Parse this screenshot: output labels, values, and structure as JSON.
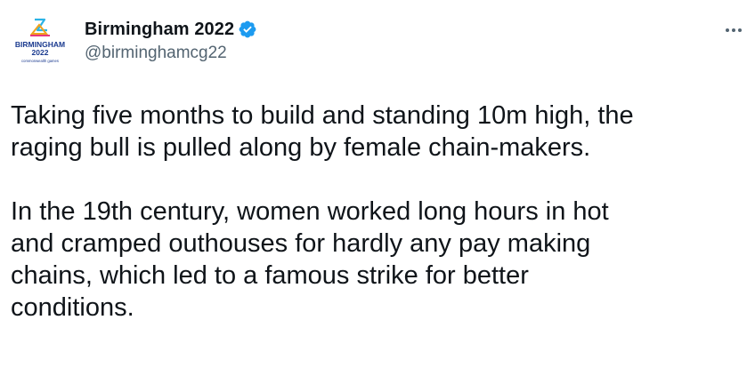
{
  "tweet": {
    "author": {
      "display_name": "Birmingham 2022",
      "handle": "@birminghamcg22",
      "verified": true,
      "avatar": {
        "icon": "birmingham-2022-logo",
        "logo_text_line1": "BIRMINGHAM",
        "logo_text_line2": "2022",
        "logo_text_line3": "commonwealth games"
      }
    },
    "more_icon": "more-horizontal-icon",
    "paragraphs": [
      {
        "lines": [
          "Taking five months to build and standing 10m high, the",
          "raging bull is pulled along by female chain-makers."
        ]
      },
      {
        "lines": [
          "In the 19th century, women worked long hours in hot",
          "and cramped outhouses for hardly any pay making",
          "chains, which led to a famous strike for better",
          "conditions."
        ]
      }
    ]
  },
  "colors": {
    "text": "#0f1419",
    "secondary_text": "#536471",
    "verified_blue": "#1d9bf0",
    "logo_blue": "#1a3a8f",
    "logo_accent": "#2bb3e6"
  }
}
